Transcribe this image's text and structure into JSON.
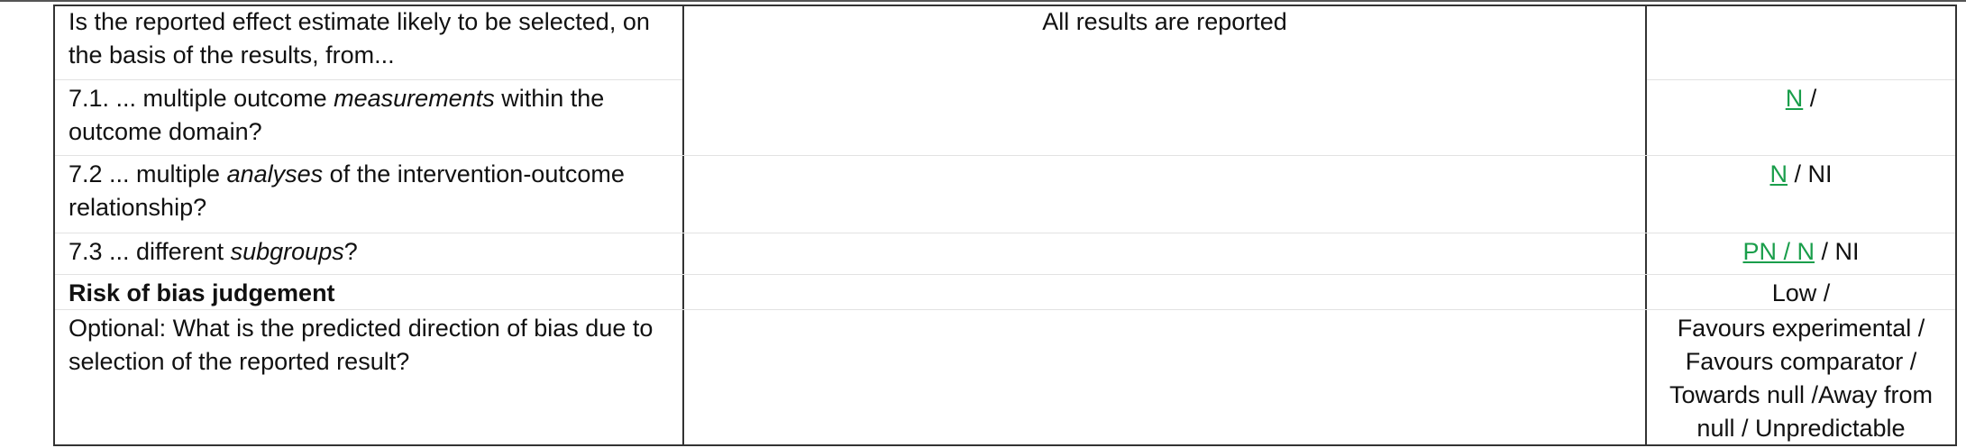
{
  "rows": {
    "intro": {
      "question": "Is the reported effect estimate likely to be selected, on the basis of the results, from...",
      "support": "All results are reported"
    },
    "q71": {
      "pre": "7.1. ... multiple outcome ",
      "em": "measurements",
      "post": " within the outcome domain?",
      "answer_highlight": "N",
      "answer_rest": " /"
    },
    "q72": {
      "pre": "7.2 ... multiple ",
      "em": "analyses",
      "post": " of the intervention-outcome relationship?",
      "answer_highlight": "N",
      "answer_rest": " / NI"
    },
    "q73": {
      "pre": "7.3 ... different ",
      "em": "subgroups",
      "post": "?",
      "answer_highlight": "PN / N",
      "answer_rest": " / NI"
    },
    "risk": {
      "label": "Risk of bias judgement",
      "answer": "Low /"
    },
    "optional": {
      "question": "Optional: What is the predicted direction of bias due to selection of the reported result?",
      "answer_lines": [
        "Favours experimental /",
        "Favours comparator /",
        "Towards null /Away from",
        "null / Unpredictable"
      ]
    }
  },
  "colors": {
    "highlight": "#1a9e4b",
    "border": "#333333"
  }
}
